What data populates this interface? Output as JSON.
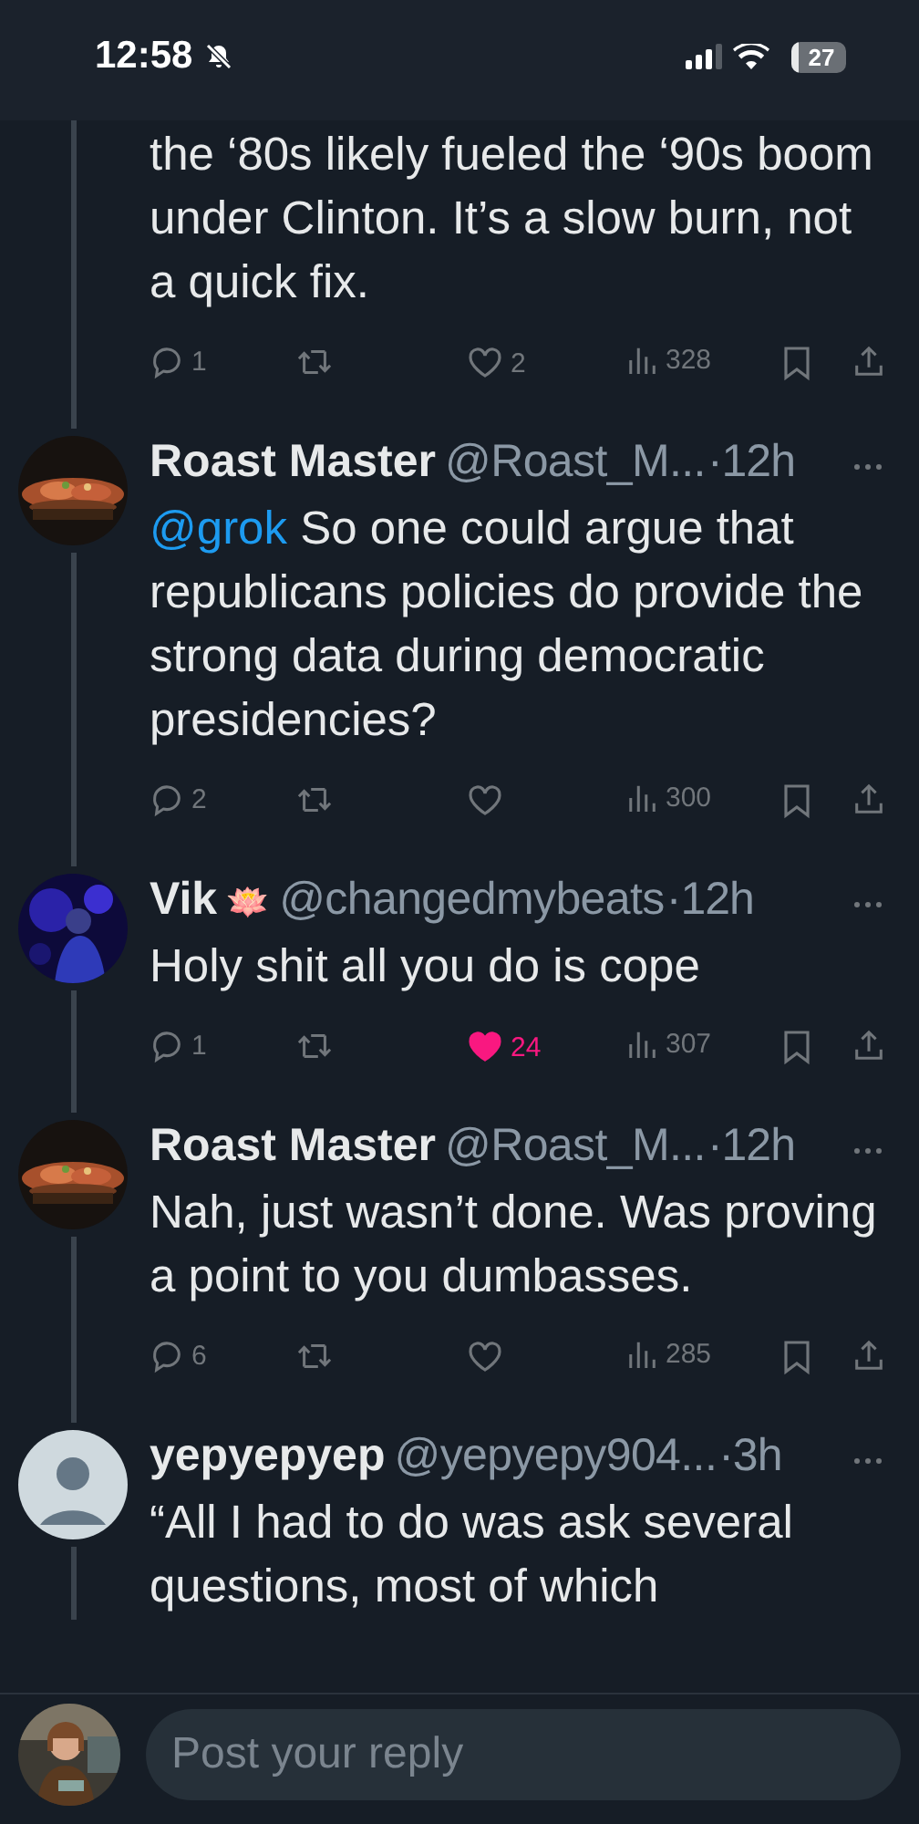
{
  "status_bar": {
    "time": "12:58",
    "muted": true,
    "battery": "27"
  },
  "posts": [
    {
      "kind": "continued",
      "text": "the ‘80s likely fueled the ‘90s boom under Clinton. It’s a slow burn, not a quick fix.",
      "stats": {
        "replies": "1",
        "likes": "2",
        "liked": false,
        "views": "328"
      }
    },
    {
      "kind": "reply",
      "name": "Roast Master",
      "handle": "@Roast_M...",
      "time": "·12h",
      "mention": "@grok",
      "text": "So one could argue that republicans policies do provide the strong data during democratic presidencies?",
      "stats": {
        "replies": "2",
        "liked": false,
        "views": "300"
      }
    },
    {
      "kind": "reply",
      "name": "Vik",
      "emoji": "🪷",
      "handle": "@changedmybeats",
      "time": "·12h",
      "text": "Holy shit all you do is cope",
      "stats": {
        "replies": "1",
        "likes": "24",
        "liked": true,
        "views": "307"
      }
    },
    {
      "kind": "reply",
      "name": "Roast Master",
      "handle": "@Roast_M...",
      "time": "·12h",
      "text": "Nah, just wasn’t done. Was proving a point to you dumbasses.",
      "stats": {
        "replies": "6",
        "liked": false,
        "views": "285"
      }
    },
    {
      "kind": "reply",
      "avatar": {
        "kind": "default"
      },
      "name": "yepyepyep",
      "handle": "@yepyepy904...",
      "time": "·3h",
      "text": "“All I had to do was ask several questions, most of which"
    }
  ],
  "composer": {
    "placeholder": "Post your reply"
  }
}
